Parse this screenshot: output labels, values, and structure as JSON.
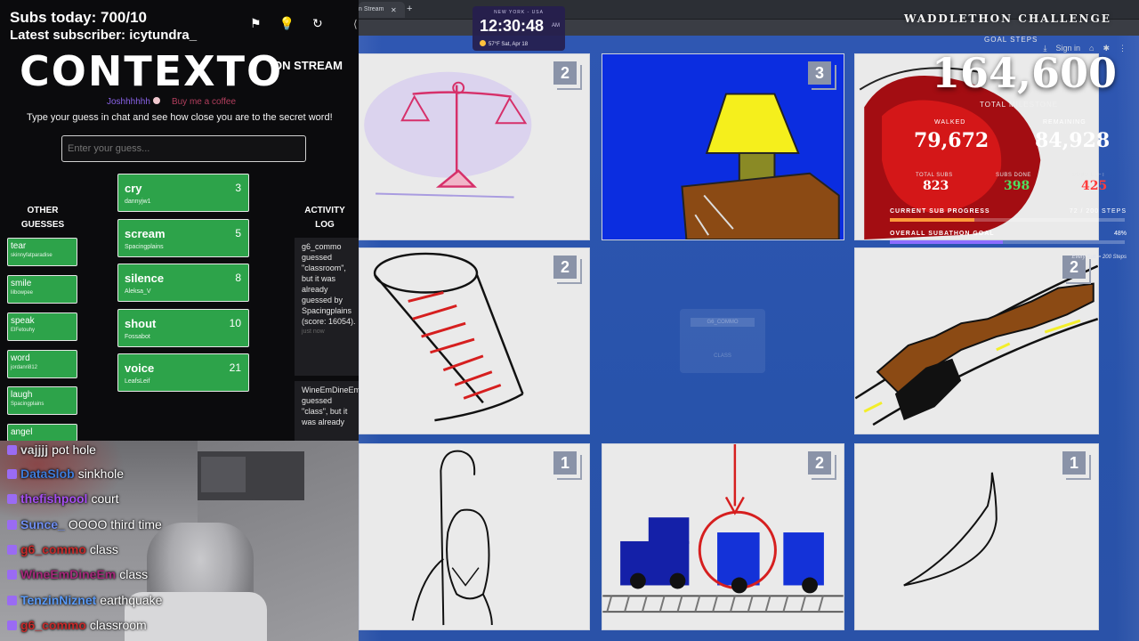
{
  "overlay": {
    "subs_today": "Subs today: 700/10",
    "latest_subscriber": "Latest subscriber: icytundra_"
  },
  "contexto": {
    "title": "CONTEXTO",
    "on_stream": "ON STREAM",
    "credit_user": "Joshhhhhh",
    "credit_coffee": "Buy me a coffee",
    "instructions": "Type your guess in chat and see how close you are to the secret word!",
    "input_placeholder": "Enter your guess...",
    "other_title": "OTHER GUESSES",
    "other_guesses": [
      {
        "word": "tear",
        "user": "skinnyfatparadise"
      },
      {
        "word": "smile",
        "user": "lilbowpee"
      },
      {
        "word": "speak",
        "user": "ElFetouhy"
      },
      {
        "word": "word",
        "user": "jordanri812"
      },
      {
        "word": "laugh",
        "user": "Spacingplains"
      },
      {
        "word": "angel",
        "user": ""
      }
    ],
    "top_guesses": [
      {
        "word": "cry",
        "user": "dannyjw1",
        "score": "3"
      },
      {
        "word": "scream",
        "user": "Spacingplains",
        "score": "5"
      },
      {
        "word": "silence",
        "user": "Aleksa_V",
        "score": "8"
      },
      {
        "word": "shout",
        "user": "Fossabot",
        "score": "10"
      },
      {
        "word": "voice",
        "user": "LeafsLeif",
        "score": "21"
      }
    ],
    "activity_title": "ACTIVITY LOG",
    "activity": [
      {
        "text": "g6_commo guessed \"classroom\", but it was already guessed by Spacingplains (score: 16054).",
        "ago": "just now"
      },
      {
        "text": "WineEmDineEm guessed \"class\", but it was already",
        "ago": ""
      }
    ]
  },
  "chat": [
    {
      "name": "vajjjj",
      "msg": "pot hole",
      "color": "#d8d8d8"
    },
    {
      "name": "DataSlob",
      "msg": "sinkhole",
      "color": "#3d7bd9"
    },
    {
      "name": "thefishpool",
      "msg": "court",
      "color": "#a54ff0"
    },
    {
      "name": "Sunce_",
      "msg": "OOOO third time",
      "color": "#6f8ef0"
    },
    {
      "name": "g6_commo",
      "msg": "class",
      "color": "#c62a2a"
    },
    {
      "name": "WineEmDineEm",
      "msg": "class",
      "color": "#a4287a"
    },
    {
      "name": "TenzinNiznet",
      "msg": "earthquake",
      "color": "#5a9af7"
    },
    {
      "name": "g6_commo",
      "msg": "classroom",
      "color": "#c62a2a"
    }
  ],
  "browser": {
    "tab_label": "n Stream",
    "sign_in": "Sign in"
  },
  "clock": {
    "city": "NEW YORK - USA",
    "time": "12:30:48",
    "ampm": "AM",
    "temp": "57°F",
    "date": "Sat, Apr 18"
  },
  "waddlethon": {
    "title": "WADDLETHON CHALLENGE",
    "goal_steps_label": "GOAL STEPS",
    "total": "164,600",
    "total_label": "TOTAL MILESTONE",
    "walked_label": "WALKED",
    "walked": "79,672",
    "remaining_label": "REMAINING",
    "remaining": "84,928",
    "total_subs_label": "TOTAL SUBS",
    "total_subs": "823",
    "subs_done_label": "SUBS DONE",
    "subs_done": "398",
    "subs_left_label": "SUBS LEFT",
    "subs_left": "425",
    "current_progress_label": "CURRENT SUB PROGRESS",
    "current_progress_value": "72 / 200 STEPS",
    "current_progress_fraction": 0.36,
    "overall_goal_label": "OVERALL SUBATHON GOAL",
    "overall_goal_value": "48%",
    "overall_goal_fraction": 0.48,
    "per_sub_note": "Every Sub = 200 Steps",
    "accent": "#ff9a3b"
  },
  "tiles": [
    {
      "count": "2"
    },
    {
      "count": "3"
    },
    {
      "count": "2"
    },
    {
      "count": "2"
    },
    {
      "count": "1"
    },
    {
      "count": "2"
    },
    {
      "count": "1"
    }
  ],
  "center_card": {
    "line1": "G6_COMMO",
    "line2": "CLASS"
  }
}
